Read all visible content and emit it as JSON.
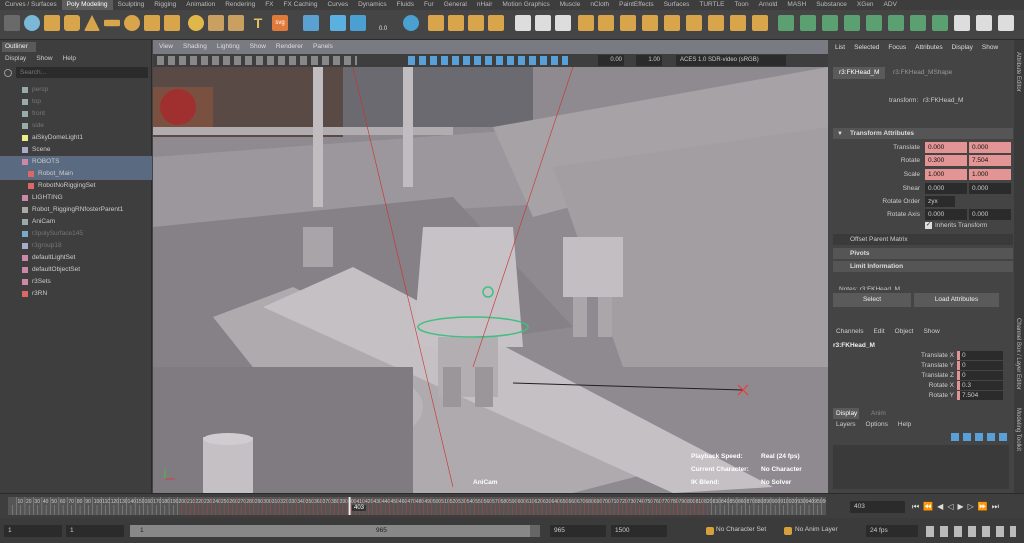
{
  "shelf": {
    "tabs": [
      "Curves / Surfaces",
      "Poly Modeling",
      "Sculpting",
      "Rigging",
      "Animation",
      "Rendering",
      "FX",
      "FX Caching",
      "Curves",
      "Dynamics",
      "Fluids",
      "Fur",
      "General",
      "nHair",
      "Motion Graphics",
      "Muscle",
      "nCloth",
      "PaintEffects",
      "Surfaces",
      "TURTLE",
      "Toon",
      "Arnold",
      "MASH",
      "Substance",
      "XGen",
      "ADV"
    ],
    "active_tab": "Poly Modeling",
    "icon_labels": {
      "text_icon": "T",
      "svg_icon": "svg",
      "value_small": "0.0",
      "value_small2": "0.0"
    }
  },
  "outliner": {
    "tab": "Outliner",
    "menu": [
      "Display",
      "Show",
      "Help"
    ],
    "search_placeholder": "Search...",
    "items": [
      {
        "label": "persp",
        "dim": true,
        "icon": "camera-icon"
      },
      {
        "label": "top",
        "dim": true,
        "icon": "camera-icon"
      },
      {
        "label": "front",
        "dim": true,
        "icon": "camera-icon"
      },
      {
        "label": "side",
        "dim": true,
        "icon": "camera-icon"
      },
      {
        "label": "aiSkyDomeLight1",
        "dim": false,
        "icon": "light-icon"
      },
      {
        "label": "Scene",
        "dim": false,
        "icon": "group-icon"
      },
      {
        "label": "ROBOTS",
        "dim": false,
        "icon": "set-icon",
        "selected": true
      },
      {
        "label": "Robot_Main",
        "dim": false,
        "icon": "reference-icon",
        "selected": true
      },
      {
        "label": "RobotNoRiggingSet",
        "dim": false,
        "icon": "reference-icon"
      },
      {
        "label": "LIGHTING",
        "dim": false,
        "icon": "set-icon"
      },
      {
        "label": "Robot_RiggingRNfosterParent1",
        "dim": false,
        "icon": "transform-icon"
      },
      {
        "label": "AniCam",
        "dim": false,
        "icon": "camera-icon"
      },
      {
        "label": "r3polySurface145",
        "dim": true,
        "icon": "mesh-icon"
      },
      {
        "label": "r3group18",
        "dim": true,
        "icon": "group-icon"
      },
      {
        "label": "defaultLightSet",
        "dim": false,
        "icon": "set-icon"
      },
      {
        "label": "defaultObjectSet",
        "dim": false,
        "icon": "set-icon"
      },
      {
        "label": "r3Sets",
        "dim": false,
        "icon": "set-icon"
      },
      {
        "label": "r3RN",
        "dim": false,
        "icon": "reference-icon"
      }
    ]
  },
  "viewport": {
    "menu": [
      "View",
      "Shading",
      "Lighting",
      "Show",
      "Renderer",
      "Panels"
    ],
    "exposure": "0.00",
    "gamma": "1.00",
    "color_space": "ACES 1.0 SDR-video (sRGB)",
    "camera_label": "AniCam",
    "hud": [
      {
        "key": "Playback Speed:",
        "value": "Real (24 fps)"
      },
      {
        "key": "Current Character:",
        "value": "No Character"
      },
      {
        "key": "IK Blend:",
        "value": "No Solver"
      }
    ]
  },
  "attribute_editor": {
    "menu": [
      "List",
      "Selected",
      "Focus",
      "Attributes",
      "Display",
      "Show"
    ],
    "tabs": [
      "r3:FKHead_M",
      "r3:FKHead_MShape"
    ],
    "transform_label": "transform:",
    "transform_value": "r3:FKHead_M",
    "section": "Transform Attributes",
    "rows": [
      {
        "label": "Translate",
        "values": [
          "0.000",
          "0.000"
        ],
        "red": true
      },
      {
        "label": "Rotate",
        "values": [
          "0.300",
          "7.504"
        ],
        "red": true
      },
      {
        "label": "Scale",
        "values": [
          "1.000",
          "1.000"
        ],
        "red": true
      },
      {
        "label": "Shear",
        "values": [
          "0.000",
          "0.000"
        ],
        "red": false
      }
    ],
    "rotate_order_label": "Rotate Order",
    "rotate_order_value": "zyx",
    "rotate_axis_label": "Rotate Axis",
    "rotate_axis_values": [
      "0.000",
      "0.000"
    ],
    "inherits_label": "Inherits Transform",
    "offset_label": "Offset Parent Matrix",
    "collapsed": [
      "Pivots",
      "Limit Information"
    ],
    "cut_label": "Notes: r3:FKHead_M",
    "select_button": "Select",
    "load_button": "Load Attributes"
  },
  "channel_box": {
    "menu": [
      "Channels",
      "Edit",
      "Object",
      "Show"
    ],
    "node": "r3:FKHead_M",
    "channels": [
      {
        "label": "Translate X",
        "value": "0"
      },
      {
        "label": "Translate Y",
        "value": "0"
      },
      {
        "label": "Translate Z",
        "value": "0"
      },
      {
        "label": "Rotate X",
        "value": "0.3"
      },
      {
        "label": "Rotate Y",
        "value": "7.504"
      }
    ],
    "layer_tabs": [
      "Display",
      "Anim"
    ],
    "layer_menu": [
      "Layers",
      "Options",
      "Help"
    ]
  },
  "side_tabs": [
    "Attribute Editor",
    "Channel Box / Layer Editor",
    "Modeling Toolkit"
  ],
  "timeline": {
    "ticks": [
      "5",
      "10",
      "15",
      "20",
      "25",
      "30",
      "35",
      "40",
      "45",
      "50",
      "55",
      "60",
      "65",
      "70",
      "75",
      "80",
      "85",
      "90",
      "95",
      "100",
      "105",
      "110",
      "115",
      "120",
      "125",
      "130",
      "135",
      "140",
      "145",
      "150",
      "155",
      "160",
      "165",
      "170",
      "175",
      "180",
      "185",
      "190",
      "195",
      "200",
      "205",
      "210",
      "215",
      "220",
      "225",
      "230",
      "235",
      "240",
      "245",
      "250",
      "255",
      "260",
      "265",
      "270",
      "275",
      "280",
      "285",
      "290",
      "295",
      "300",
      "305",
      "310",
      "315",
      "320",
      "325",
      "330",
      "335",
      "340",
      "345",
      "350",
      "355",
      "360",
      "365",
      "370",
      "375",
      "380",
      "385",
      "390",
      "395",
      "400",
      "405",
      "410",
      "415",
      "420",
      "425",
      "430",
      "435",
      "440",
      "445",
      "450",
      "455",
      "460",
      "465",
      "470",
      "475",
      "480",
      "485",
      "490",
      "495",
      "500",
      "505",
      "510",
      "515",
      "520",
      "525",
      "530",
      "535",
      "540",
      "545",
      "550",
      "555",
      "560",
      "565",
      "570",
      "575",
      "580",
      "585",
      "590",
      "595",
      "600",
      "605",
      "610",
      "615",
      "620",
      "625",
      "630",
      "635",
      "640",
      "645",
      "650",
      "655",
      "660",
      "665",
      "670",
      "675",
      "680",
      "685",
      "690",
      "695",
      "700",
      "705",
      "710",
      "715",
      "720",
      "725",
      "730",
      "735",
      "740",
      "745",
      "750",
      "755",
      "760",
      "765",
      "770",
      "775",
      "780",
      "785",
      "790",
      "795",
      "800",
      "805",
      "810",
      "815",
      "820",
      "825",
      "830",
      "835",
      "840",
      "845",
      "850",
      "855",
      "860",
      "865",
      "870",
      "875",
      "880",
      "885",
      "890",
      "895",
      "900",
      "905",
      "910",
      "915",
      "920",
      "925",
      "930",
      "935",
      "940",
      "945",
      "950",
      "955",
      "960"
    ],
    "current_frame": "403",
    "current_frame_field": "403"
  },
  "range_bar": {
    "start": "1",
    "anim_start": "1",
    "range_start_label": "1",
    "range_end_label": "965",
    "anim_end": "965",
    "end": "1500",
    "character_set": "No Character Set",
    "anim_layer": "No Anim Layer",
    "fps": "24 fps"
  }
}
